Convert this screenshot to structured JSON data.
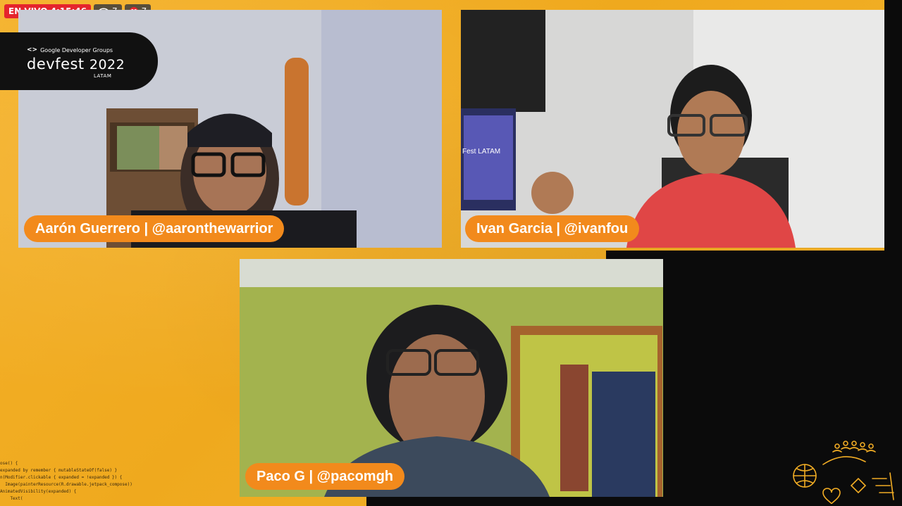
{
  "live": {
    "label": "EN VIVO 4:15:46",
    "viewers": "7",
    "likes": "7"
  },
  "brand": {
    "org": "Google Developer Groups",
    "name": "devfest",
    "year": "2022",
    "region": "LATAM"
  },
  "participants": [
    {
      "name": "Aarón Guerrero | @aaronthewarrior"
    },
    {
      "name": "Ivan Garcia | @ivanfou"
    },
    {
      "name": "Paco G | @pacomgh"
    }
  ],
  "monitor_text": "Fest LATAM",
  "code_lines": [
    "ose() {",
    "",
    "expanded by remember { mutableStateOf(false) }",
    "n(Modifier.clickable { expanded = !expanded }) {",
    "  Image(painterResource(R.drawable.jetpack_compose))",
    "AnimatedVisibility(expanded) {",
    "    Text("
  ],
  "colors": {
    "accent": "#f28a1c",
    "live": "#e5252d",
    "background": "#f2ad24"
  },
  "icons": [
    "eye-icon",
    "heart-icon",
    "code-brackets-icon",
    "doodle-icon"
  ]
}
